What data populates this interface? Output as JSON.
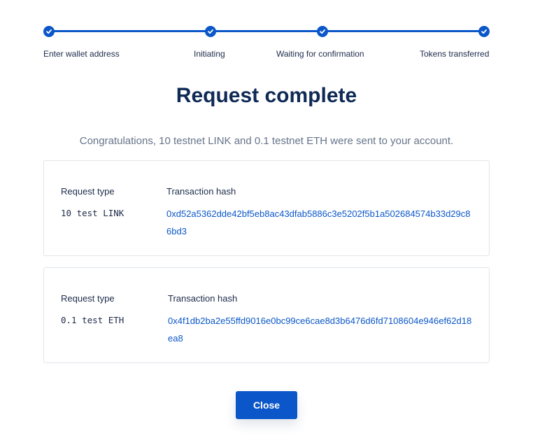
{
  "colors": {
    "accent": "#0b57c9",
    "title": "#0f2a55",
    "text": "#1d2b4a",
    "muted": "#66748a",
    "border": "#e1e5ec"
  },
  "stepper": {
    "steps": [
      {
        "label": "Enter wallet address",
        "completed": true,
        "icon": "check-icon"
      },
      {
        "label": "Initiating",
        "completed": true,
        "icon": "check-icon"
      },
      {
        "label": "Waiting for confirmation",
        "completed": true,
        "icon": "check-icon"
      },
      {
        "label": "Tokens transferred",
        "completed": true,
        "icon": "check-icon"
      }
    ]
  },
  "main": {
    "title": "Request complete",
    "message": "Congratulations, 10 testnet LINK and 0.1 testnet ETH were sent to your account."
  },
  "requests": [
    {
      "type_header": "Request type",
      "hash_header": "Transaction hash",
      "type": "10 test LINK",
      "hash": "0xd52a5362dde42bf5eb8ac43dfab5886c3e5202f5b1a502684574b33d29c86bd3"
    },
    {
      "type_header": "Request type",
      "hash_header": "Transaction hash",
      "type": "0.1 test ETH",
      "hash": "0x4f1db2ba2e55ffd9016e0bc99ce6cae8d3b6476d6fd7108604e946ef62d18ea8"
    }
  ],
  "actions": {
    "close_label": "Close"
  }
}
